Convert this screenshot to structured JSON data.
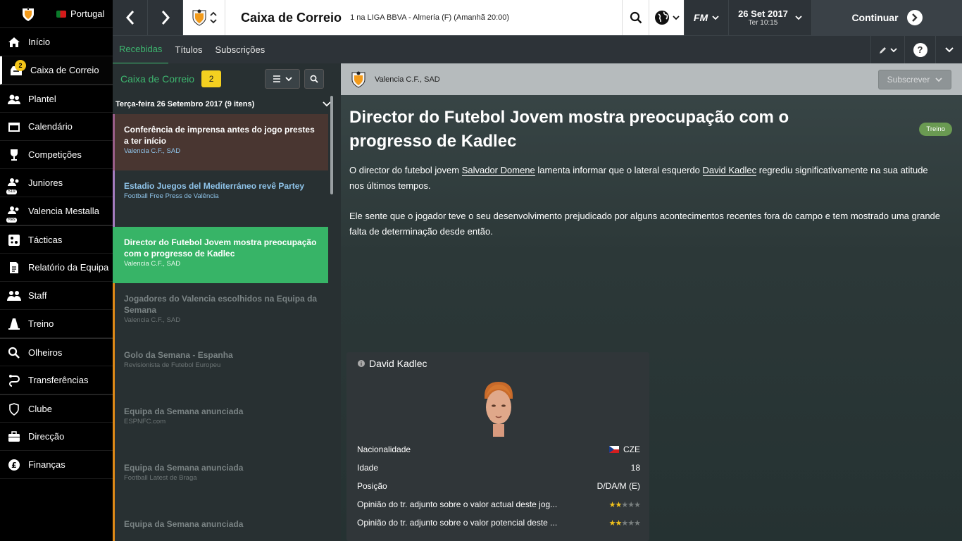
{
  "sidebar": {
    "nation": "Portugal",
    "inbox_badge": "2",
    "items": [
      {
        "label": "Início"
      },
      {
        "label": "Caixa de Correio"
      },
      {
        "label": "Plantel"
      },
      {
        "label": "Calendário"
      },
      {
        "label": "Competições"
      },
      {
        "label": "Juniores",
        "sub": "S19"
      },
      {
        "label": "Valencia Mestalla",
        "sub": "Res"
      },
      {
        "label": "Tácticas"
      },
      {
        "label": "Relatório da Equipa"
      },
      {
        "label": "Staff"
      },
      {
        "label": "Treino"
      },
      {
        "label": "Olheiros"
      },
      {
        "label": "Transferências"
      },
      {
        "label": "Clube"
      },
      {
        "label": "Direcção"
      },
      {
        "label": "Finanças"
      }
    ]
  },
  "topbar": {
    "title": "Caixa de Correio",
    "next_fixture": "1 na LIGA BBVA - Almería (F) (Amanhã 20:00)",
    "fm_label": "FM",
    "date": "26 Set 2017",
    "time": "Ter 10:15",
    "continue_label": "Continuar"
  },
  "tabs": [
    {
      "label": "Recebidas"
    },
    {
      "label": "Títulos"
    },
    {
      "label": "Subscrições"
    }
  ],
  "inbox": {
    "title": "Caixa de Correio",
    "count": "2",
    "date_group": "Terça-feira 26 Setembro 2017 (9 itens)",
    "messages": [
      {
        "title": "Conferência de imprensa antes do jogo prestes a ter início",
        "source": "Valencia C.F., SAD"
      },
      {
        "title": "Estadio Juegos del Mediterráneo revê Partey",
        "source": "Football Free Press de Valência"
      },
      {
        "title": "Director do Futebol Jovem mostra preocupação com o progresso de Kadlec",
        "source": "Valencia C.F., SAD"
      },
      {
        "title": "Jogadores do Valencia escolhidos na Equipa da Semana",
        "source": "Valencia C.F., SAD"
      },
      {
        "title": "Golo da Semana - Espanha",
        "source": "Revisionista de Futebol Europeu"
      },
      {
        "title": "Equipa da Semana anunciada",
        "source": "ESPNFC.com"
      },
      {
        "title": "Equipa da Semana anunciada",
        "source": "Football Latest de Braga"
      },
      {
        "title": "Equipa da Semana anunciada",
        "source": ""
      }
    ]
  },
  "message": {
    "sender": "Valencia C.F., SAD",
    "subscribe_label": "Subscrever",
    "headline": "Director do Futebol Jovem mostra preocupação com o progresso de Kadlec",
    "tag": "Treino",
    "p1_a": "O director do futebol jovem ",
    "p1_name1": "Salvador Domene",
    "p1_b": " lamenta informar que o lateral esquerdo ",
    "p1_name2": "David Kadlec",
    "p1_c": " regrediu significativamente na sua atitude nos últimos tempos.",
    "p2": "Ele sente que o jogador teve o seu desenvolvimento prejudicado por alguns acontecimentos recentes fora do campo e tem mostrado uma grande falta de determinação desde então."
  },
  "player_card": {
    "name": "David Kadlec",
    "rows": [
      {
        "label": "Nacionalidade",
        "value": "CZE"
      },
      {
        "label": "Idade",
        "value": "18"
      },
      {
        "label": "Posição",
        "value": "D/DA/M (E)"
      },
      {
        "label": "Opinião do tr. adjunto sobre o valor actual deste jog...",
        "stars": 1.5
      },
      {
        "label": "Opinião do tr. adjunto sobre o valor potencial deste ...",
        "stars": 1.5
      }
    ]
  }
}
